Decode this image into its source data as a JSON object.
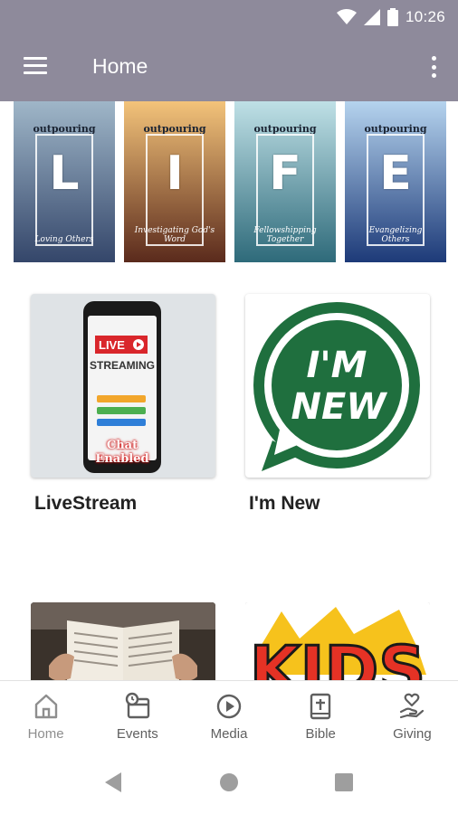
{
  "status_bar": {
    "time": "10:26"
  },
  "app_bar": {
    "title": "Home"
  },
  "banner": {
    "panels": [
      {
        "brand": "outpouring",
        "letter": "L",
        "caption": "Loving Others",
        "sky_top": "#9fb6c8",
        "sky_bottom": "#34466a"
      },
      {
        "brand": "outpouring",
        "letter": "I",
        "caption": "Investigating God's Word",
        "sky_top": "#f3c37a",
        "sky_bottom": "#5a2a1c"
      },
      {
        "brand": "outpouring",
        "letter": "F",
        "caption": "Fellowshipping Together",
        "sky_top": "#bfe0e6",
        "sky_bottom": "#2e6a7a"
      },
      {
        "brand": "outpouring",
        "letter": "E",
        "caption": "Evangelizing Others",
        "sky_top": "#b5d3ee",
        "sky_bottom": "#1d3a78"
      }
    ]
  },
  "cards": [
    {
      "label": "LiveStream",
      "art": "livestream-phone"
    },
    {
      "label": "I'm New",
      "art": "im-new-speech-bubble"
    },
    {
      "label": "",
      "art": "open-bible"
    },
    {
      "label": "",
      "art": "kids-logo"
    }
  ],
  "livestream_art": {
    "live": "LIVE",
    "streaming": "STREAMING",
    "chat": "Chat Enabled"
  },
  "im_new_art": {
    "line1": "I'M",
    "line2": "NEW",
    "color": "#1f6f3e"
  },
  "kids_art": {
    "text": "KIDS"
  },
  "bottom_nav": {
    "items": [
      {
        "label": "Home",
        "icon": "home-icon"
      },
      {
        "label": "Events",
        "icon": "calendar-clock-icon"
      },
      {
        "label": "Media",
        "icon": "play-circle-icon"
      },
      {
        "label": "Bible",
        "icon": "bible-icon"
      },
      {
        "label": "Giving",
        "icon": "giving-hand-heart-icon"
      }
    ]
  },
  "colors": {
    "app_bar": "#8e8a9b",
    "nav_active": "#8e8e8e",
    "nav_text": "#5f5f5f"
  }
}
